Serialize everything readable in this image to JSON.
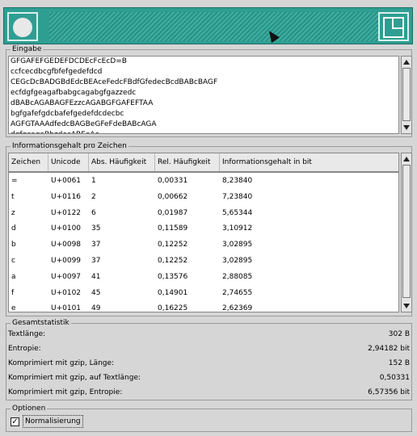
{
  "input": {
    "title": "Eingabe",
    "lines": [
      "GFGAFEFGEDEFDCDEcFcEcD=B",
      "ccfcecdbcgfbfefgedefdcd",
      "CEGcDcBADGBdEdcBEAceFedcFBdfGfedecBcdBABcBAGF",
      "ecfdgfgeagafbabgcagabgfgazzedc",
      "dBABcAGABAGFEzzcAGABGFGAFEFTAA",
      "bgfgafefgdcbafefgedefdcdecbc",
      "AGFGTAAAdfedcBAGBeGFeFdeBABcAGA",
      "dgfgcagaBbzdecABEeAe"
    ]
  },
  "info": {
    "title": "Informationsgehalt pro Zeichen",
    "columns": [
      "Zeichen",
      "Unicode",
      "Abs. Häufigkeit",
      "Rel. Häufigkeit",
      "Informationsgehalt in bit"
    ],
    "rows": [
      [
        "=",
        "U+0061",
        "1",
        "0,00331",
        "8,23840"
      ],
      [
        "t",
        "U+0116",
        "2",
        "0,00662",
        "7,23840"
      ],
      [
        "z",
        "U+0122",
        "6",
        "0,01987",
        "5,65344"
      ],
      [
        "d",
        "U+0100",
        "35",
        "0,11589",
        "3,10912"
      ],
      [
        "b",
        "U+0098",
        "37",
        "0,12252",
        "3,02895"
      ],
      [
        "c",
        "U+0099",
        "37",
        "0,12252",
        "3,02895"
      ],
      [
        "a",
        "U+0097",
        "41",
        "0,13576",
        "2,88085"
      ],
      [
        "f",
        "U+0102",
        "45",
        "0,14901",
        "2,74655"
      ],
      [
        "e",
        "U+0101",
        "49",
        "0,16225",
        "2,62369"
      ]
    ]
  },
  "stats": {
    "title": "Gesamtstatistik",
    "rows": [
      {
        "label": "Textlänge:",
        "value": "302 B"
      },
      {
        "label": "Entropie:",
        "value": "2,94182 bit"
      },
      {
        "label": "Komprimiert mit gzip, Länge:",
        "value": "152 B"
      },
      {
        "label": "Komprimiert mit gzip, auf Textlänge:",
        "value": "0,50331"
      },
      {
        "label": "Komprimiert mit gzip, Entropie:",
        "value": "6,57356 bit"
      }
    ]
  },
  "options": {
    "title": "Optionen",
    "normalize_label": "Normalisierung",
    "normalize_checked": true,
    "check_glyph": "✓"
  },
  "colors": {
    "titlebar": "#2f9e92",
    "background": "#d6d6d6"
  }
}
